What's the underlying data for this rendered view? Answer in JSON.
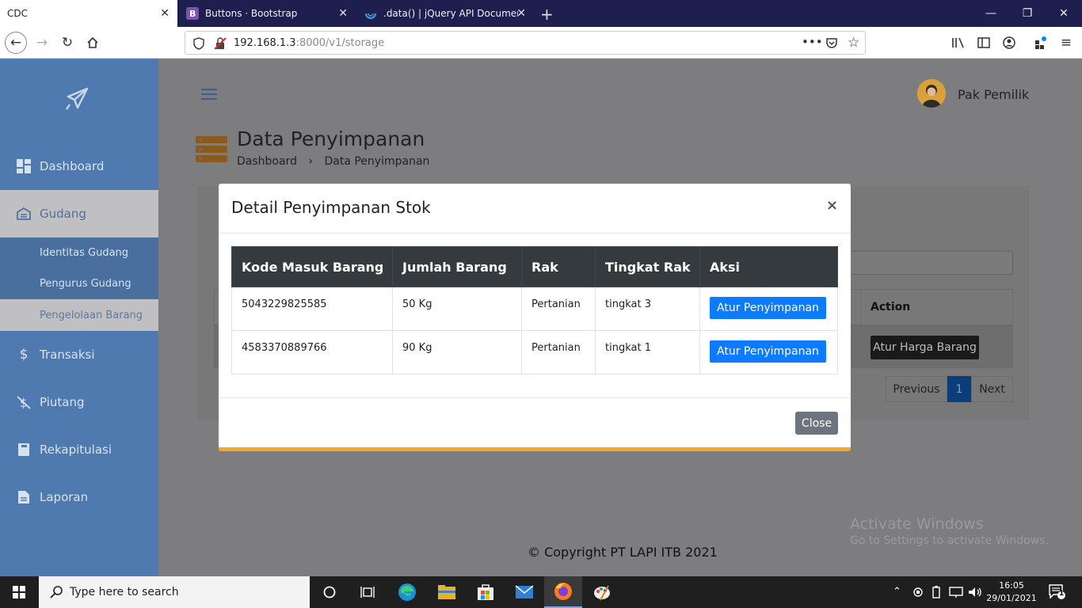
{
  "browser": {
    "tabs": [
      {
        "title": "CDC"
      },
      {
        "title": "Buttons · Bootstrap"
      },
      {
        "title": ".data() | jQuery API Documenta"
      }
    ],
    "url_host": "192.168.1.3",
    "url_rest": ":8000/v1/storage"
  },
  "sidebar": {
    "items": [
      {
        "label": "Dashboard",
        "icon": "dashboard-icon"
      },
      {
        "label": "Gudang",
        "icon": "warehouse-icon"
      },
      {
        "label": "Transaksi",
        "icon": "dollar-icon"
      },
      {
        "label": "Piutang",
        "icon": "receivable-icon"
      },
      {
        "label": "Rekapitulasi",
        "icon": "book-icon"
      },
      {
        "label": "Laporan",
        "icon": "report-icon"
      }
    ],
    "submenu": [
      {
        "label": "Identitas Gudang"
      },
      {
        "label": "Pengurus Gudang"
      },
      {
        "label": "Pengelolaan Barang"
      }
    ]
  },
  "header": {
    "username": "Pak Pemilik"
  },
  "page": {
    "title": "Data Penyimpanan",
    "breadcrumb": [
      "Dashboard",
      "Data Penyimpanan"
    ],
    "table_header_action": "Action",
    "row_button": "Atur Harga Barang",
    "pager": {
      "previous": "Previous",
      "current": "1",
      "next": "Next"
    }
  },
  "modal": {
    "title": "Detail Penyimpanan Stok",
    "close_x": "×",
    "columns": [
      "Kode Masuk Barang",
      "Jumlah Barang",
      "Rak",
      "Tingkat Rak",
      "Aksi"
    ],
    "rows": [
      {
        "kode": "5043229825585",
        "jumlah": "50 Kg",
        "rak": "Pertanian",
        "tingkat": "tingkat 3",
        "aksi": "Atur Penyimpanan"
      },
      {
        "kode": "4583370889766",
        "jumlah": "90 Kg",
        "rak": "Pertanian",
        "tingkat": "tingkat 1",
        "aksi": "Atur Penyimpanan"
      }
    ],
    "close_button": "Close"
  },
  "footer": {
    "copyright": "© Copyright PT LAPI ITB 2021"
  },
  "watermark": {
    "line1": "Activate Windows",
    "line2": "Go to Settings to activate Windows."
  },
  "taskbar": {
    "search_placeholder": "Type here to search",
    "time": "16:05",
    "date": "29/01/2021",
    "notification_count": "1"
  },
  "colors": {
    "sidebar": "#4f7ab0",
    "modal_accent": "#f1a82c",
    "primary": "#0d7bff",
    "table_head": "#353a3f"
  }
}
